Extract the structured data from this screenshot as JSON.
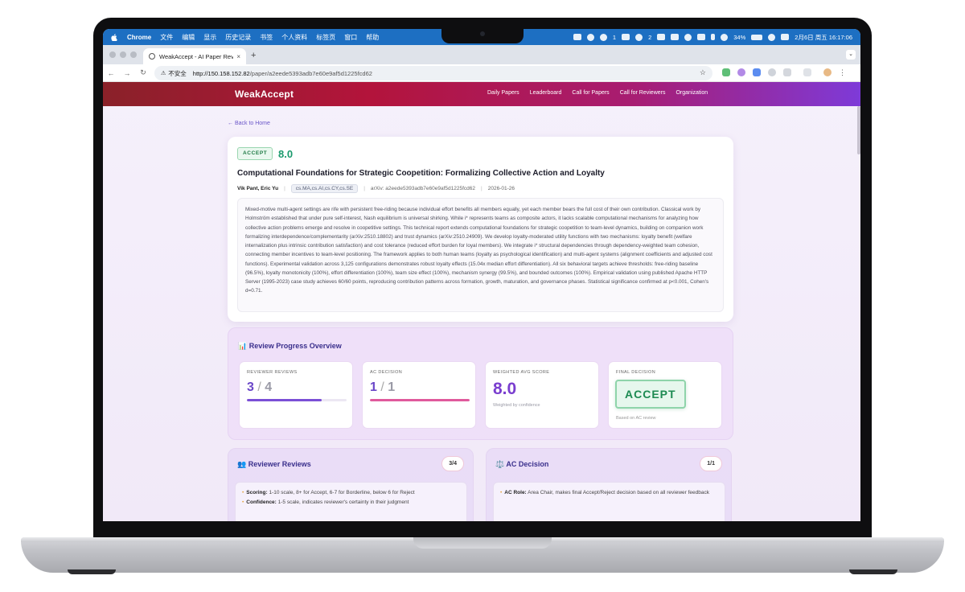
{
  "menubar": {
    "app": "Chrome",
    "items": [
      "文件",
      "编辑",
      "显示",
      "历史记录",
      "书签",
      "个人资料",
      "标签页",
      "窗口",
      "帮助"
    ],
    "status": {
      "notif1": "1",
      "notif2": "2",
      "battery": "34%",
      "datetime": "2月6日 周五  16:17:06"
    }
  },
  "browser": {
    "tab_title": "WeakAccept - AI Paper Revie",
    "tab_close": "×",
    "new_tab": "+",
    "insecure_label": "不安全",
    "url_host": "http://150.158.152.82",
    "url_path": "/paper/a2eede5393adb7e60e9af5d1225fcd62"
  },
  "site": {
    "brand": "WeakAccept",
    "nav": [
      "Daily Papers",
      "Leaderboard",
      "Call for Papers",
      "Call for Reviewers",
      "Organization"
    ],
    "back": "← Back to Home"
  },
  "paper": {
    "decision_badge": "ACCEPT",
    "score": "8.0",
    "title": "Computational Foundations for Strategic Coopetition: Formalizing Collective Action and Loyalty",
    "authors": "Vik Pant, Eric Yu",
    "categories": "cs.MA,cs.AI,cs.CY,cs.SE",
    "arxiv": "arXiv: a2eede5393adb7e60e9af5d1225fcd62",
    "date": "2026-01-26",
    "abstract": "Mixed-motive multi-agent settings are rife with persistent free-riding because individual effort benefits all members equally, yet each member bears the full cost of their own contribution. Classical work by Holmström established that under pure self-interest, Nash equilibrium is universal shirking. While i* represents teams as composite actors, it lacks scalable computational mechanisms for analyzing how collective action problems emerge and resolve in coopetitive settings. This technical report extends computational foundations for strategic coopetition to team-level dynamics, building on companion work formalizing interdependence/complementarity (arXiv:2510.18802) and trust dynamics (arXiv:2510.24909). We develop loyalty-moderated utility functions with two mechanisms: loyalty benefit (welfare internalization plus intrinsic contribution satisfaction) and cost tolerance (reduced effort burden for loyal members). We integrate i* structural dependencies through dependency-weighted team cohesion, connecting member incentives to team-level positioning. The framework applies to both human teams (loyalty as psychological identification) and multi-agent systems (alignment coefficients and adjusted cost functions). Experimental validation across 3,125 configurations demonstrates robust loyalty effects (15.04x median effort differentiation). All six behavioral targets achieve thresholds: free-riding baseline (96.5%), loyalty monotonicity (100%), effort differentiation (100%), team size effect (100%), mechanism synergy (99.5%), and bounded outcomes (100%). Empirical validation using published Apache HTTP Server (1995-2023) case study achieves 60/60 points, reproducing contribution patterns across formation, growth, maturation, and governance phases. Statistical significance confirmed at p<0.001, Cohen's d=0.71."
  },
  "progress": {
    "title": "📊 Review Progress Overview",
    "reviewer_reviews": {
      "label": "REVIEWER REVIEWS",
      "done": "3",
      "slash": "/",
      "total": "4",
      "fraction": 0.75,
      "color": "#7b4fd6"
    },
    "ac_decision": {
      "label": "AC DECISION",
      "done": "1",
      "slash": "/",
      "total": "1",
      "fraction": 1.0,
      "color": "#e05a9c"
    },
    "weighted": {
      "label": "WEIGHTED AVG SCORE",
      "value": "8.0",
      "sub": "Weighted by confidence"
    },
    "final": {
      "label": "FINAL DECISION",
      "value": "ACCEPT",
      "sub": "Based on AC review"
    }
  },
  "reviewer_section": {
    "title": "👥 Reviewer Reviews",
    "count": "3/4",
    "scoring_label": "Scoring:",
    "scoring_text": " 1-10 scale, 8+ for Accept, 6-7 for Borderline, below 6 for Reject",
    "confidence_label": "Confidence:",
    "confidence_text": " 1-5 scale, indicates reviewer's certainty in their judgment"
  },
  "ac_section": {
    "title": "⚖️ AC Decision",
    "count": "1/1",
    "role_label": "AC Role:",
    "role_text": " Area Chair, makes final Accept/Reject decision based on all reviewer feedback"
  },
  "colors": {
    "accent": "#6b47c8",
    "accept_green": "#1d8a52",
    "nav_start": "#8a2129",
    "nav_end": "#7e3ad8"
  }
}
